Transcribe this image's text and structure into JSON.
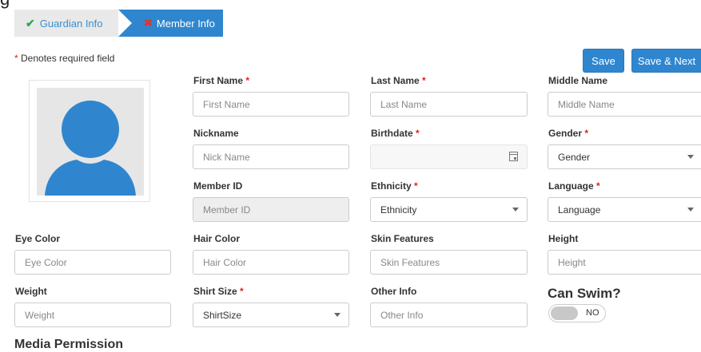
{
  "top_clip_text": "g",
  "wizard": {
    "steps": [
      {
        "label": "Guardian Info",
        "status": "complete"
      },
      {
        "label": "Member Info",
        "status": "incomplete"
      }
    ]
  },
  "required_note": "Denotes required field",
  "buttons": {
    "save": "Save",
    "save_next": "Save & Next"
  },
  "fields": {
    "first_name": {
      "label": "First Name",
      "placeholder": "First Name",
      "required": true
    },
    "last_name": {
      "label": "Last Name",
      "placeholder": "Last Name",
      "required": true
    },
    "middle_name": {
      "label": "Middle Name",
      "placeholder": "Middle Name",
      "required": false
    },
    "nickname": {
      "label": "Nickname",
      "placeholder": "Nick Name",
      "required": false
    },
    "birthdate": {
      "label": "Birthdate",
      "value": "",
      "required": true
    },
    "gender": {
      "label": "Gender",
      "value": "Gender",
      "required": true
    },
    "member_id": {
      "label": "Member ID",
      "placeholder": "Member ID",
      "required": false
    },
    "ethnicity": {
      "label": "Ethnicity",
      "value": "Ethnicity",
      "required": true
    },
    "language": {
      "label": "Language",
      "value": "Language",
      "required": true
    },
    "eye_color": {
      "label": "Eye Color",
      "placeholder": "Eye Color"
    },
    "hair_color": {
      "label": "Hair Color",
      "placeholder": "Hair Color"
    },
    "skin_features": {
      "label": "Skin Features",
      "placeholder": "Skin Features"
    },
    "height": {
      "label": "Height",
      "placeholder": "Height"
    },
    "weight": {
      "label": "Weight",
      "placeholder": "Weight"
    },
    "shirt_size": {
      "label": "Shirt Size",
      "value": "ShirtSize",
      "required": true
    },
    "other_info": {
      "label": "Other Info",
      "placeholder": "Other Info"
    }
  },
  "can_swim": {
    "label": "Can Swim?",
    "toggle_text": "NO"
  },
  "bottom_section_title": "Media Permission",
  "colors": {
    "primary": "#2f86cf",
    "required": "#e02020",
    "check": "#2fa84f"
  },
  "icons": {
    "step_complete": "check-icon",
    "step_incomplete": "x-icon",
    "avatar": "user-avatar-icon",
    "calendar": "calendar-icon"
  }
}
